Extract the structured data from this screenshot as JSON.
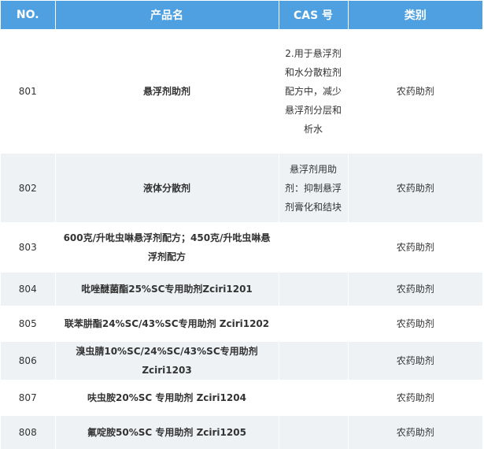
{
  "table": {
    "headers": [
      "NO.",
      "产品名",
      "CAS 号",
      "类别"
    ],
    "rows": [
      {
        "no": "801",
        "name": "悬浮剂助剂",
        "cas": "2.用于悬浮剂和水分散粒剂配方中，减少悬浮剂分层和析水",
        "category": "农药助剂"
      },
      {
        "no": "802",
        "name": "液体分散剂",
        "cas": "悬浮剂用助剂：抑制悬浮剂膏化和结块",
        "category": "农药助剂"
      },
      {
        "no": "803",
        "name": "600克/升吡虫啉悬浮剂配方；450克/升吡虫啉悬浮剂配方",
        "cas": "",
        "category": "农药助剂"
      },
      {
        "no": "804",
        "name": "吡唑醚菌酯25%SC专用助剂Zciri1201",
        "cas": "",
        "category": "农药助剂"
      },
      {
        "no": "805",
        "name": "联苯肼酯24%SC/43%SC专用助剂 Zciri1202",
        "cas": "",
        "category": "农药助剂"
      },
      {
        "no": "806",
        "name": "溴虫腈10%SC/24%SC/43%SC专用助剂 Zciri1203",
        "cas": "",
        "category": "农药助剂"
      },
      {
        "no": "807",
        "name": "呋虫胺20%SC 专用助剂 Zciri1204",
        "cas": "",
        "category": "农药助剂"
      },
      {
        "no": "808",
        "name": "氟啶胺50%SC 专用助剂 Zciri1205",
        "cas": "",
        "category": "农药助剂"
      }
    ]
  }
}
